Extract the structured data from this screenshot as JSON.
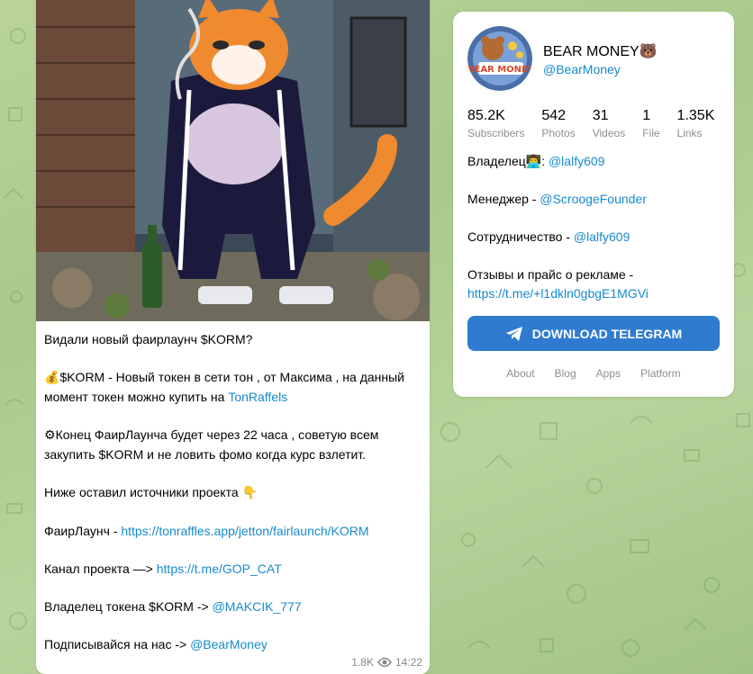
{
  "post": {
    "image_alt": "Pixel-art cat in tracksuit smoking in an alley",
    "paragraphs": [
      {
        "text": "Видали новый фаирлаунч $KORM?"
      },
      {
        "emoji": "💰",
        "text": "$KORM - Новый токен в сети тон , от Максима , на данный момент токен можно купить на ",
        "link": "TonRaffels"
      },
      {
        "emoji": "⚙",
        "text": "Конец ФаирЛаунча будет через 22 часа , советую всем закупить $KORM и не ловить фомо когда курс взлетит."
      },
      {
        "text": "Ниже оставил источники проекта ",
        "emoji_after": "👇"
      },
      {
        "text": "ФаирЛаунч - ",
        "link": "https://tonraffles.app/jetton/fairlaunch/KORM"
      },
      {
        "text": "Канал проекта —> ",
        "link": "https://t.me/GOP_CAT"
      },
      {
        "text": "Владелец токена $KORM -> ",
        "link": "@MAKCIK_777"
      },
      {
        "text": "Подписывайся на нас -> ",
        "link": "@BearMoney"
      }
    ],
    "views": "1.8K",
    "time": "14:22"
  },
  "channel": {
    "title": "BEAR MONEY🐻",
    "handle": "@BearMoney",
    "avatar_text": "BEAR MONEY",
    "stats": [
      {
        "value": "85.2K",
        "label": "Subscribers"
      },
      {
        "value": "542",
        "label": "Photos"
      },
      {
        "value": "31",
        "label": "Videos"
      },
      {
        "value": "1",
        "label": "File"
      },
      {
        "value": "1.35K",
        "label": "Links"
      }
    ],
    "description": [
      {
        "text": "Владелец👨‍💻: ",
        "link": "@lalfy609"
      },
      {
        "text": "Менеджер - ",
        "link": "@ScroogeFounder"
      },
      {
        "text": "Сотрудничество - ",
        "link": "@lalfy609"
      },
      {
        "text": "Отзывы и прайс о рекламе - ",
        "link": "https://t.me/+l1dkln0gbgE1MGVi"
      }
    ],
    "download_label": "DOWNLOAD TELEGRAM",
    "footer": [
      "About",
      "Blog",
      "Apps",
      "Platform"
    ]
  }
}
